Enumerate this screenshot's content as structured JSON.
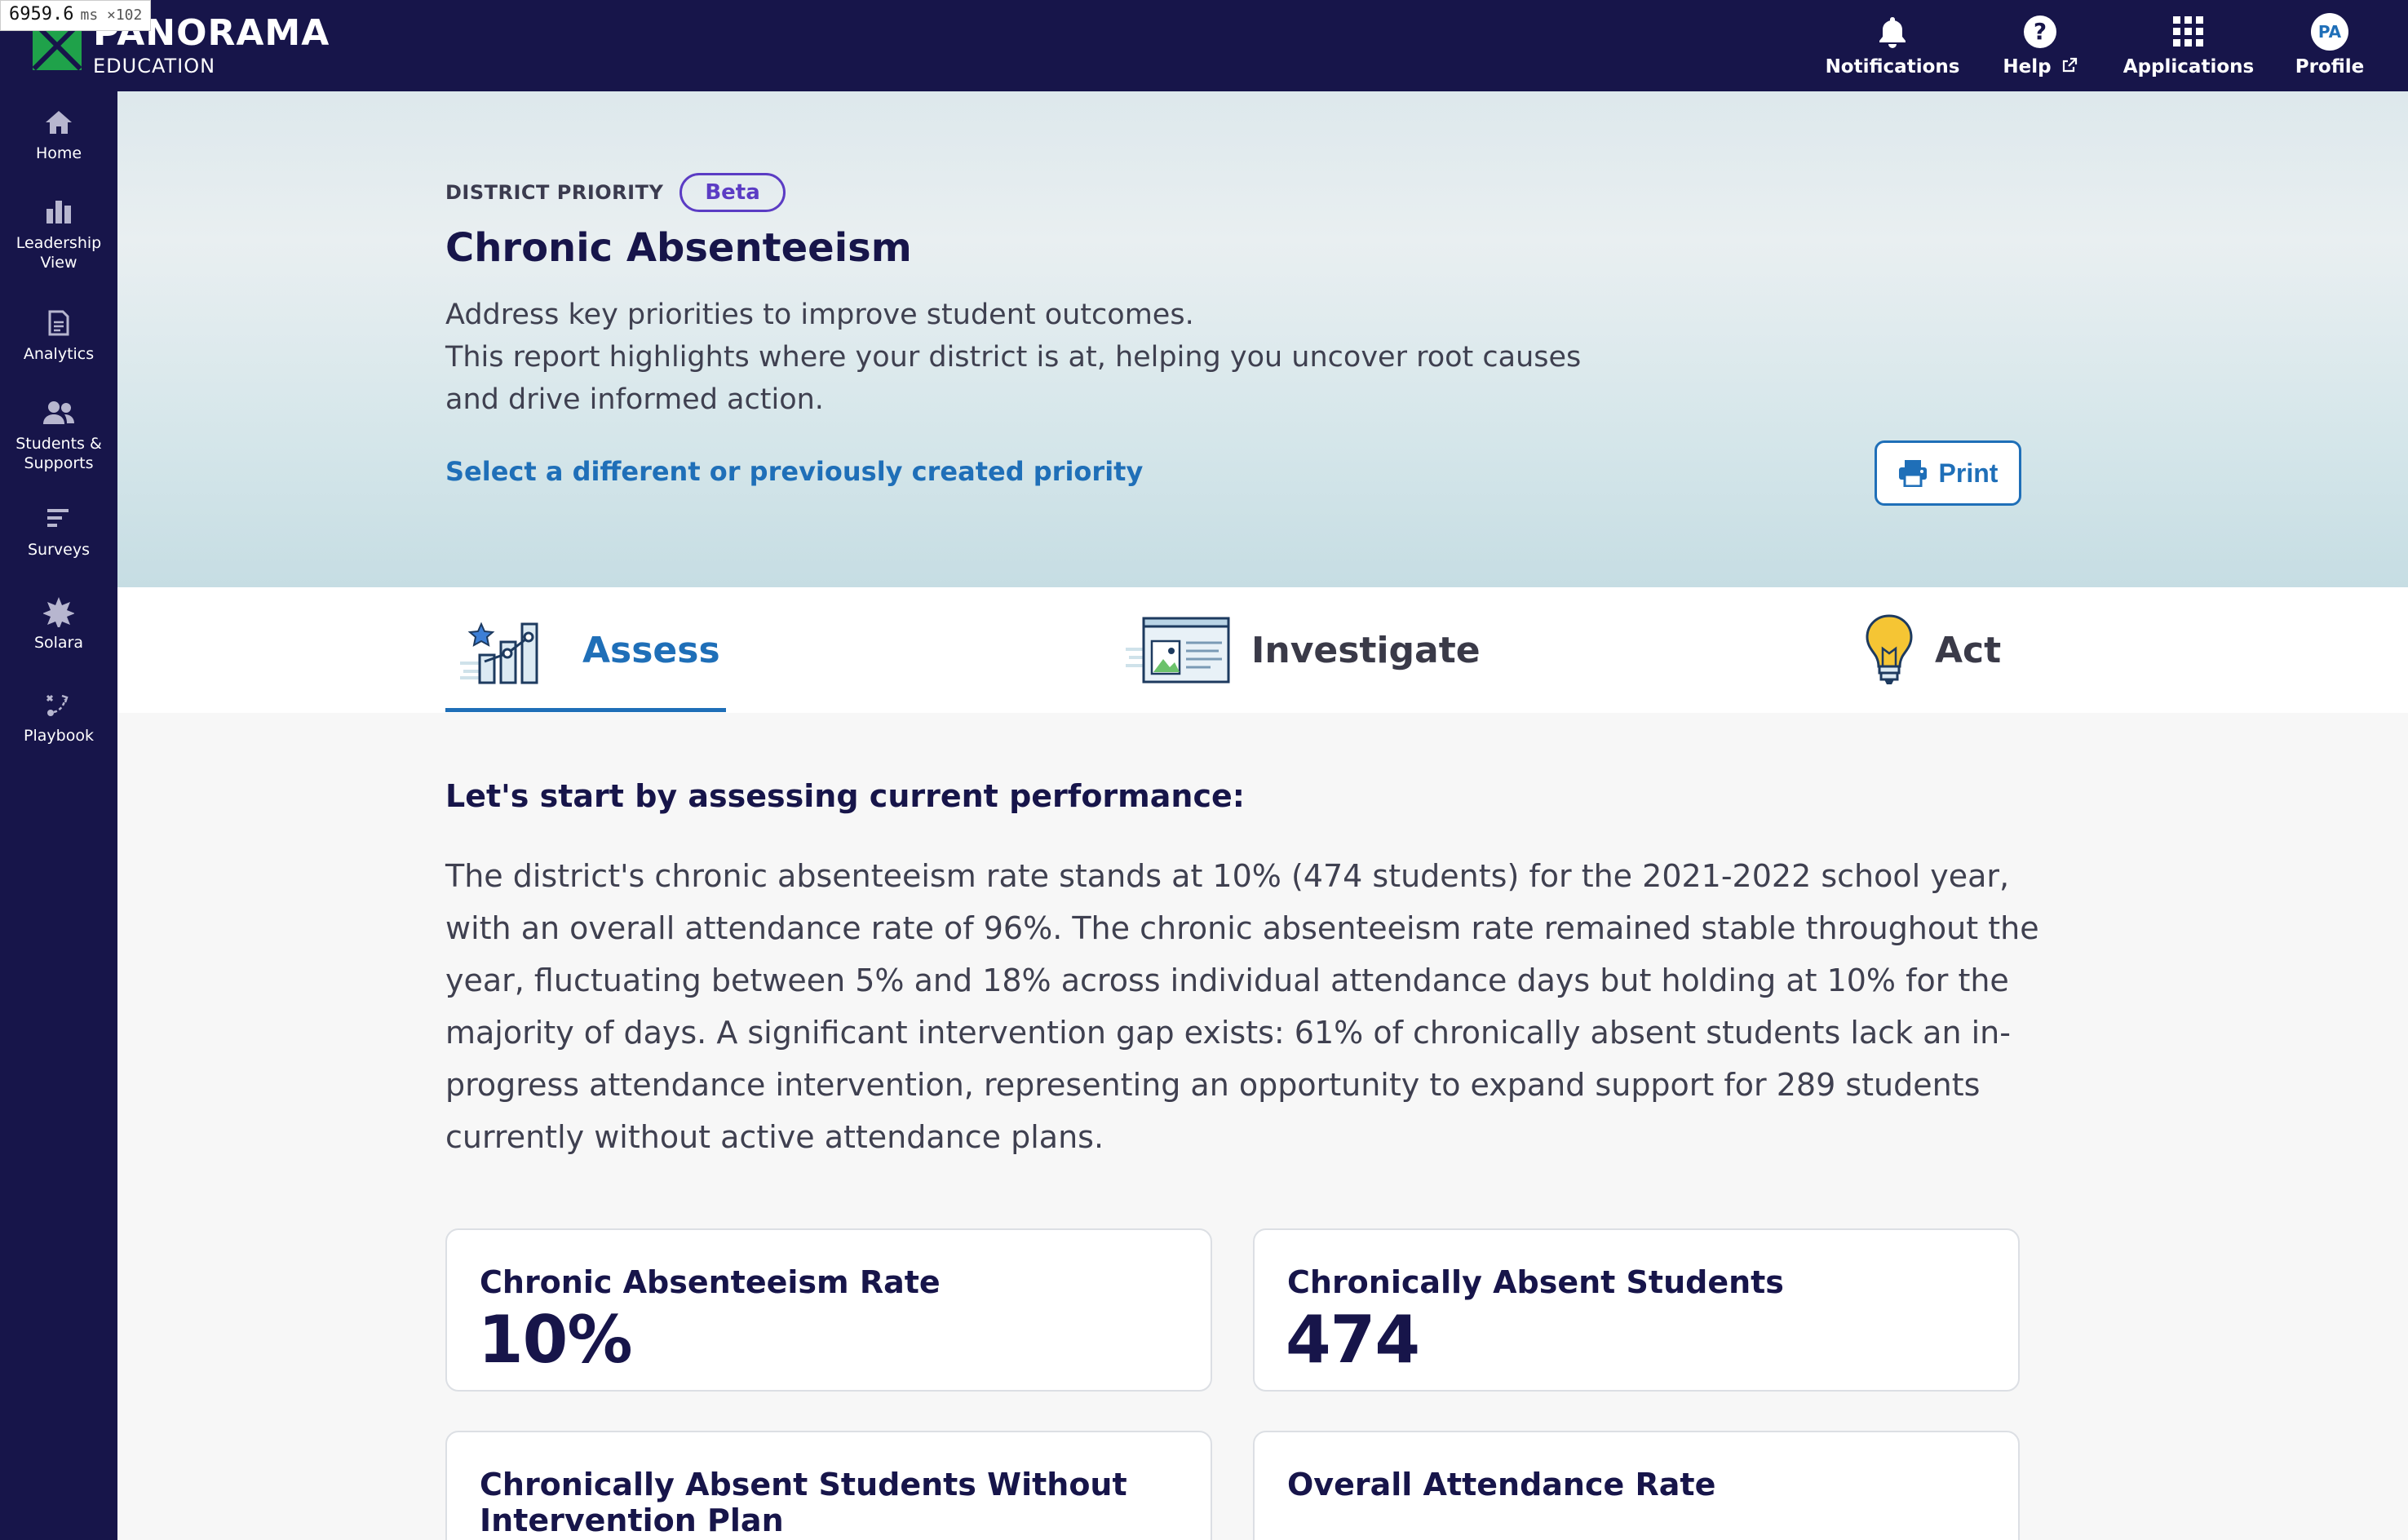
{
  "perf": {
    "value": "6959.6",
    "unit": "ms ×102"
  },
  "brand": {
    "name": "PANORAMA",
    "sub": "EDUCATION"
  },
  "topnav": {
    "notifications": "Notifications",
    "help": "Help",
    "applications": "Applications",
    "profile": "Profile",
    "avatar_initials": "PA"
  },
  "sidebar": {
    "items": [
      {
        "label": "Home",
        "icon": "home-icon"
      },
      {
        "label": "Leadership View",
        "icon": "bar-chart-icon"
      },
      {
        "label": "Analytics",
        "icon": "report-icon"
      },
      {
        "label": "Students & Supports",
        "icon": "people-icon"
      },
      {
        "label": "Surveys",
        "icon": "survey-icon"
      },
      {
        "label": "Solara",
        "icon": "sparkle-icon"
      },
      {
        "label": "Playbook",
        "icon": "playbook-icon"
      }
    ]
  },
  "hero": {
    "eyebrow": "DISTRICT PRIORITY",
    "badge": "Beta",
    "title": "Chronic Absenteeism",
    "description_line1": "Address key priorities to improve student outcomes.",
    "description_line2": "This report highlights where your district is at, helping you uncover root causes and drive informed action.",
    "link": "Select a different or previously created priority",
    "print": "Print"
  },
  "tabs": [
    {
      "label": "Assess",
      "active": true,
      "icon": "assess-chart-icon"
    },
    {
      "label": "Investigate",
      "active": false,
      "icon": "investigate-document-icon"
    },
    {
      "label": "Act",
      "active": false,
      "icon": "lightbulb-icon"
    }
  ],
  "content": {
    "section_title": "Let's start by assessing current performance:",
    "summary": "The district's chronic absenteeism rate stands at 10% (474 students) for the 2021-2022 school year, with an overall attendance rate of 96%. The chronic absenteeism rate remained stable throughout the year, fluctuating between 5% and 18% across individual attendance days but holding at 10% for the majority of days. A significant intervention gap exists: 61% of chronically absent students lack an in-progress attendance intervention, representing an opportunity to expand support for 289 students currently without active attendance plans."
  },
  "cards": [
    {
      "title": "Chronic Absenteeism Rate",
      "value": "10%"
    },
    {
      "title": "Chronically Absent Students",
      "value": "474"
    },
    {
      "title": "Chronically Absent Students Without Intervention Plan",
      "value": ""
    },
    {
      "title": "Overall Attendance Rate",
      "value": ""
    }
  ],
  "colors": {
    "navy": "#17154a",
    "accent_blue": "#1f6fb8",
    "beta_purple": "#5b3cc4",
    "brand_green": "#1fa24a"
  }
}
